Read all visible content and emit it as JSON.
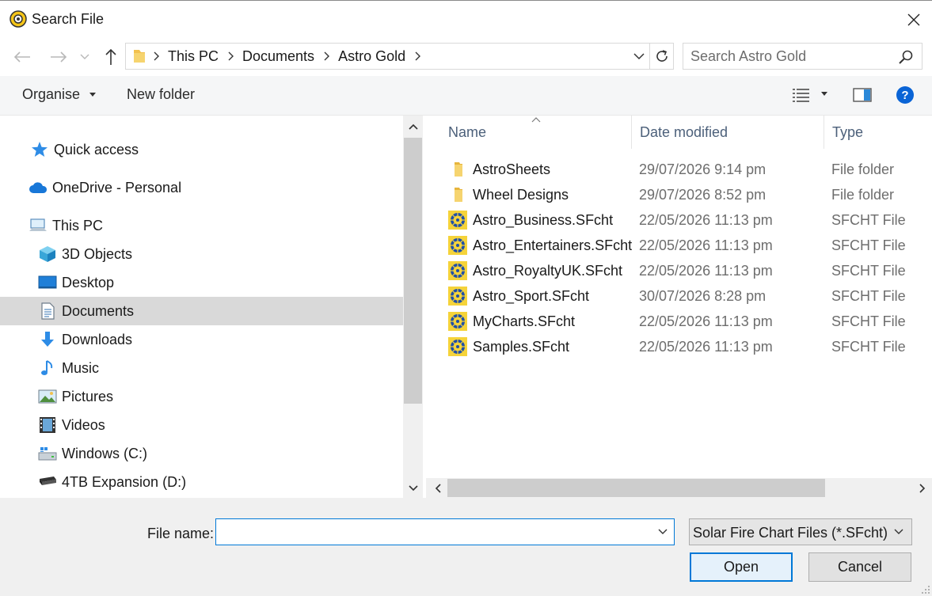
{
  "window": {
    "title": "Search File",
    "close_label": "Close"
  },
  "address": {
    "crumbs": [
      "This PC",
      "Documents",
      "Astro Gold"
    ]
  },
  "search": {
    "placeholder": "Search Astro Gold"
  },
  "toolbar": {
    "organise_label": "Organise",
    "new_folder_label": "New folder"
  },
  "nav": {
    "items": [
      {
        "label": "Quick access",
        "icon": "star-icon"
      },
      {
        "label": "OneDrive - Personal",
        "icon": "cloud-icon"
      },
      {
        "label": "This PC",
        "icon": "computer-icon"
      },
      {
        "label": "3D Objects",
        "icon": "cube-icon"
      },
      {
        "label": "Desktop",
        "icon": "desktop-icon"
      },
      {
        "label": "Documents",
        "icon": "document-icon",
        "selected": true
      },
      {
        "label": "Downloads",
        "icon": "download-arrow-icon"
      },
      {
        "label": "Music",
        "icon": "music-note-icon"
      },
      {
        "label": "Pictures",
        "icon": "picture-icon"
      },
      {
        "label": "Videos",
        "icon": "film-icon"
      },
      {
        "label": "Windows (C:)",
        "icon": "drive-icon"
      },
      {
        "label": "4TB Expansion (D:)",
        "icon": "external-drive-icon"
      }
    ]
  },
  "files": {
    "columns": [
      "Name",
      "Date modified",
      "Type"
    ],
    "rows": [
      {
        "name": "AstroSheets",
        "date": "29/07/2026 9:14 pm",
        "type": "File folder",
        "icon": "folder-icon"
      },
      {
        "name": "Wheel Designs",
        "date": "29/07/2026 8:52 pm",
        "type": "File folder",
        "icon": "folder-icon"
      },
      {
        "name": "Astro_Business.SFcht",
        "date": "22/05/2026 11:13 pm",
        "type": "SFCHT File",
        "icon": "chart-file-icon"
      },
      {
        "name": "Astro_Entertainers.SFcht",
        "date": "22/05/2026 11:13 pm",
        "type": "SFCHT File",
        "icon": "chart-file-icon"
      },
      {
        "name": "Astro_RoyaltyUK.SFcht",
        "date": "22/05/2026 11:13 pm",
        "type": "SFCHT File",
        "icon": "chart-file-icon"
      },
      {
        "name": "Astro_Sport.SFcht",
        "date": "30/07/2026 8:28 pm",
        "type": "SFCHT File",
        "icon": "chart-file-icon"
      },
      {
        "name": "MyCharts.SFcht",
        "date": "22/05/2026 11:13 pm",
        "type": "SFCHT File",
        "icon": "chart-file-icon"
      },
      {
        "name": "Samples.SFcht",
        "date": "22/05/2026 11:13 pm",
        "type": "SFCHT File",
        "icon": "chart-file-icon"
      }
    ]
  },
  "bottom": {
    "file_name_label": "File name:",
    "file_name_value": "",
    "filter_value": "Solar Fire Chart Files (*.SFcht)",
    "open_label": "Open",
    "cancel_label": "Cancel"
  },
  "colors": {
    "accent": "#0078d7",
    "selected_bg": "#d9d9d9",
    "header_text": "#4c607a"
  }
}
